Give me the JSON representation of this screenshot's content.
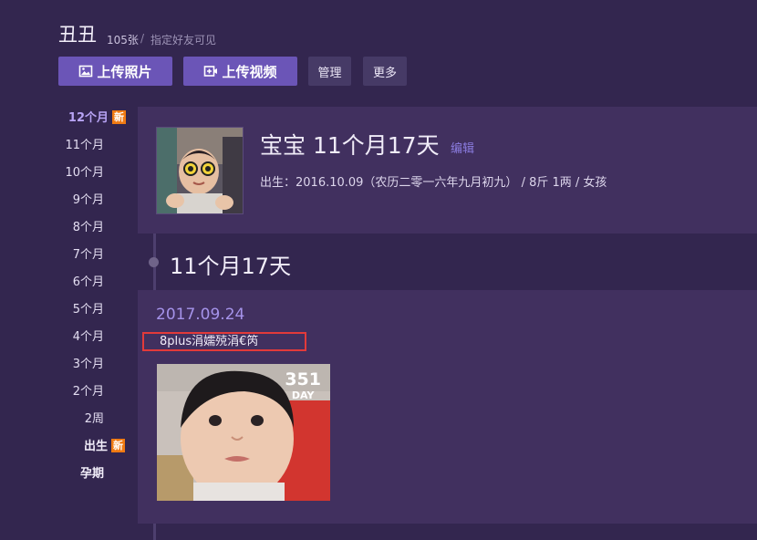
{
  "header": {
    "album_title": "丑丑",
    "photo_count": "105张",
    "separator": "/",
    "privacy": "指定好友可见"
  },
  "toolbar": {
    "upload_photo": "上传照片",
    "upload_video": "上传视频",
    "manage": "管理",
    "more": "更多"
  },
  "timeline_nav": {
    "items": [
      {
        "label": "12个月",
        "badge": "新"
      },
      {
        "label": "11个月"
      },
      {
        "label": "10个月"
      },
      {
        "label": "9个月"
      },
      {
        "label": "8个月"
      },
      {
        "label": "7个月"
      },
      {
        "label": "6个月"
      },
      {
        "label": "5个月"
      },
      {
        "label": "4个月"
      },
      {
        "label": "3个月"
      },
      {
        "label": "2个月"
      },
      {
        "label": "2周"
      },
      {
        "label": "出生",
        "badge": "新"
      },
      {
        "label": "孕期"
      }
    ]
  },
  "profile": {
    "name": "宝宝 11个月17天",
    "edit": "编辑",
    "birth": "出生：2016.10.09（农历二零一六年九月初九） /  8斤 1两  /  女孩"
  },
  "timeline": {
    "age_heading": "11个月17天"
  },
  "post": {
    "date": "2017.09.24",
    "caption": "8plus涓嬬殑涓€笍",
    "day_number": "351",
    "day_label": "DAY"
  },
  "colors": {
    "background": "#33264f",
    "card": "#41305f",
    "accent": "#6b55b7",
    "badge": "#f07a12",
    "highlight_border": "#e23a3a"
  }
}
